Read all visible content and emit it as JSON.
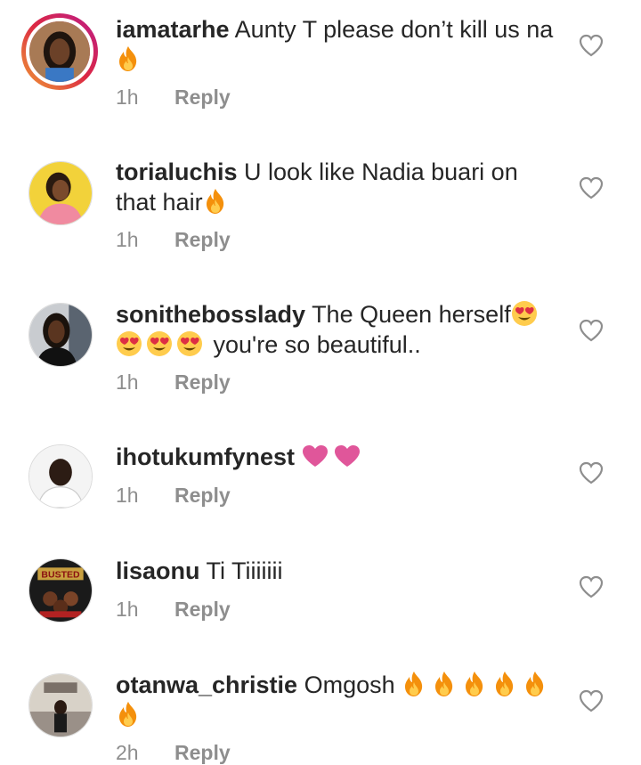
{
  "comments": [
    {
      "username": "iamatarhe",
      "text": "Aunty T please don’t kill us na",
      "emojis": [
        "fire-icon"
      ],
      "time": "1h",
      "reply": "Reply"
    },
    {
      "username": "torialuchis",
      "text": "U look like Nadia buari on that hair",
      "emojis": [
        "fire-icon"
      ],
      "time": "1h",
      "reply": "Reply"
    },
    {
      "username": "sonitheboss​lady",
      "text": "The Queen herself",
      "text_after": "you're so beautiful..",
      "emojis": [
        "heart-eyes-icon",
        "heart-eyes-icon",
        "heart-eyes-icon",
        "heart-eyes-icon"
      ],
      "time": "1h",
      "reply": "Reply"
    },
    {
      "username": "ihotukumfynest",
      "text": "",
      "emojis": [
        "pink-heart-icon",
        "pink-heart-icon"
      ],
      "time": "1h",
      "reply": "Reply"
    },
    {
      "username": "lisaonu",
      "text": "Ti Tiiiiiii",
      "emojis": [],
      "avatar_text": "BUSTED",
      "time": "1h",
      "reply": "Reply"
    },
    {
      "username": "otanwa_christie",
      "text": "Omgosh",
      "emojis": [
        "fire-icon",
        "fire-icon",
        "fire-icon",
        "fire-icon",
        "fire-icon",
        "fire-icon"
      ],
      "time": "2h",
      "reply": "Reply"
    }
  ],
  "colors": {
    "text": "#262626",
    "muted": "#8e8e8e",
    "heart_pink": "#e0569a",
    "fire_orange": "#f4900c"
  }
}
